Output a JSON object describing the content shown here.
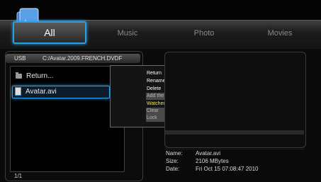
{
  "tabs": [
    "All",
    "Music",
    "Photo",
    "Movies"
  ],
  "path": {
    "device": "USB",
    "location": "C:/Avatar.2009.FRENCH.DVDF"
  },
  "files": {
    "return_label": "Return...",
    "selected_file": "Avatar.avi"
  },
  "page_counter": "1/1",
  "context_menu": {
    "items": [
      "Return",
      "Rename",
      "Delete",
      "Add the torrent",
      "Watched",
      "Clear",
      "Lock"
    ]
  },
  "info": {
    "name_label": "Name:",
    "name_value": "Avatar.avi",
    "size_label": "Size:",
    "size_value": "2106 MBytes",
    "date_label": "Date:",
    "date_value": "Fri Oct 15 07:08:47 2010"
  },
  "colors": {
    "accent": "#2b9fe6",
    "highlight": "#f2e64a"
  }
}
